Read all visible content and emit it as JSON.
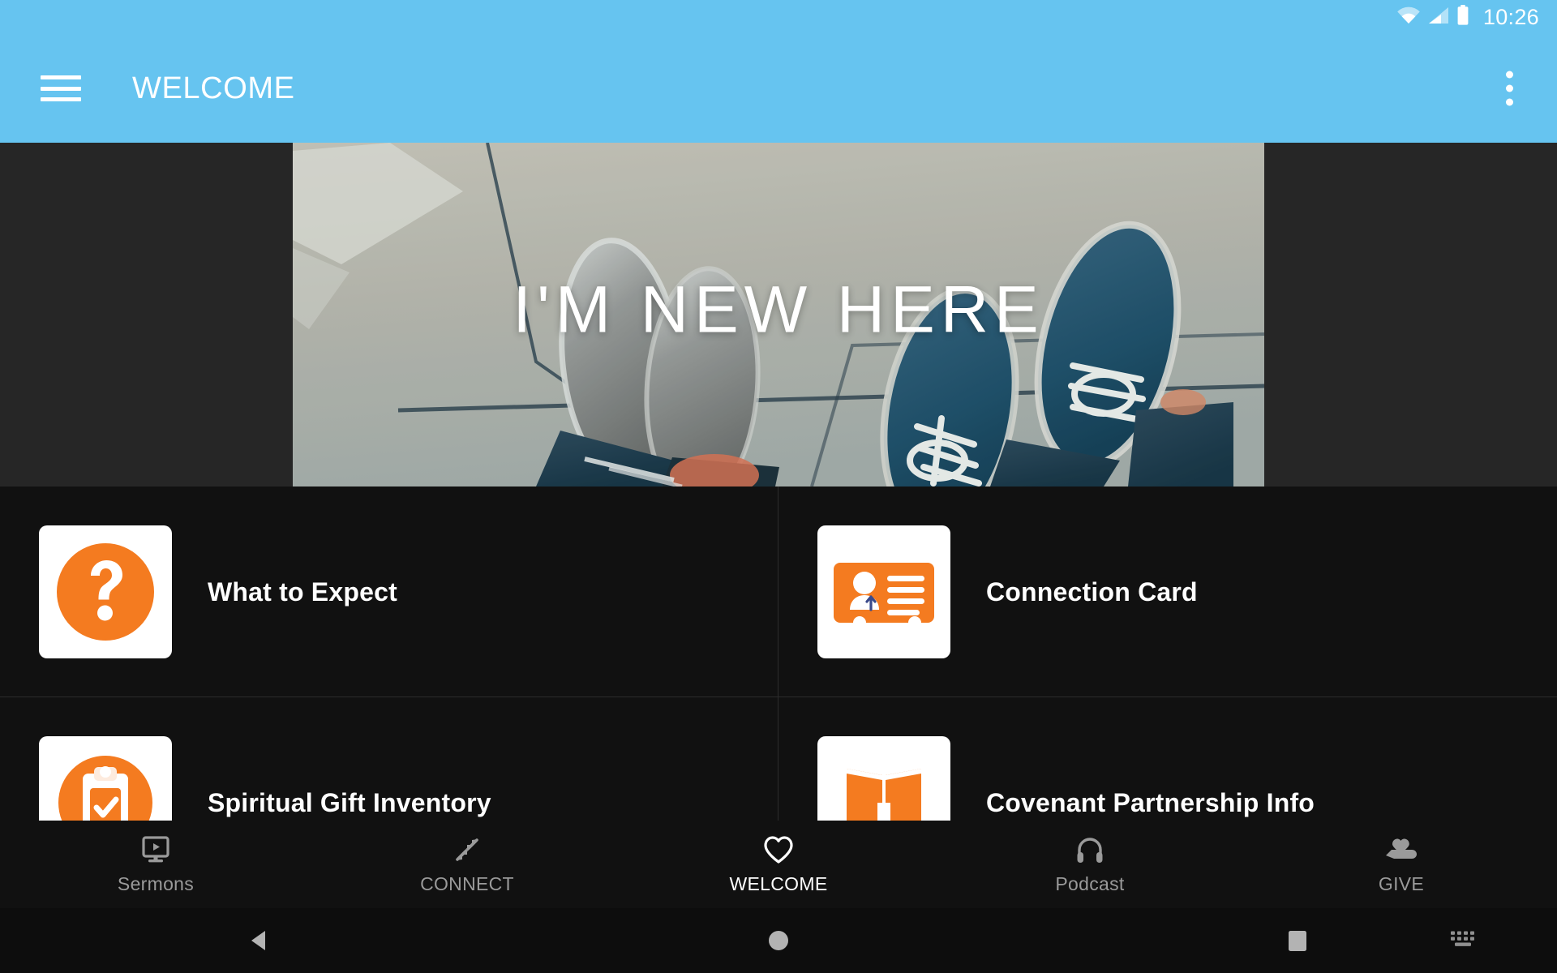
{
  "status_bar": {
    "time": "10:26",
    "icons": [
      "wifi-icon",
      "cell-signal-icon",
      "battery-icon"
    ]
  },
  "app_bar": {
    "menu_icon": "hamburger-menu-icon",
    "title": "WELCOME",
    "overflow_icon": "overflow-menu-icon",
    "background_color": "#66C4F0"
  },
  "hero": {
    "caption": "I'M NEW HERE",
    "image_alt": "two-pairs-of-shoes-on-concrete",
    "background_color": "#262626"
  },
  "list": {
    "items": [
      {
        "label": "What to Expect",
        "icon": "question-mark-icon"
      },
      {
        "label": "Connection Card",
        "icon": "id-card-icon"
      },
      {
        "label": "Spiritual Gift Inventory",
        "icon": "clipboard-check-icon"
      },
      {
        "label": "Covenant Partnership Info",
        "icon": "open-book-icon"
      }
    ],
    "accent_color": "#F47B20",
    "background_color": "#111111"
  },
  "bottom_nav": {
    "items": [
      {
        "label": "Sermons",
        "icon": "monitor-play-icon",
        "active": false
      },
      {
        "label": "CONNECT",
        "icon": "converge-arrows-icon",
        "active": false
      },
      {
        "label": "WELCOME",
        "icon": "heart-icon",
        "active": true
      },
      {
        "label": "Podcast",
        "icon": "headphones-icon",
        "active": false
      },
      {
        "label": "GIVE",
        "icon": "giving-hand-icon",
        "active": false
      }
    ],
    "active_color": "#ffffff",
    "inactive_color": "#9a9a9a"
  },
  "system_nav": {
    "back": "back-triangle-icon",
    "home": "home-circle-icon",
    "recents": "recents-square-icon",
    "keyboard": "keyboard-icon"
  }
}
